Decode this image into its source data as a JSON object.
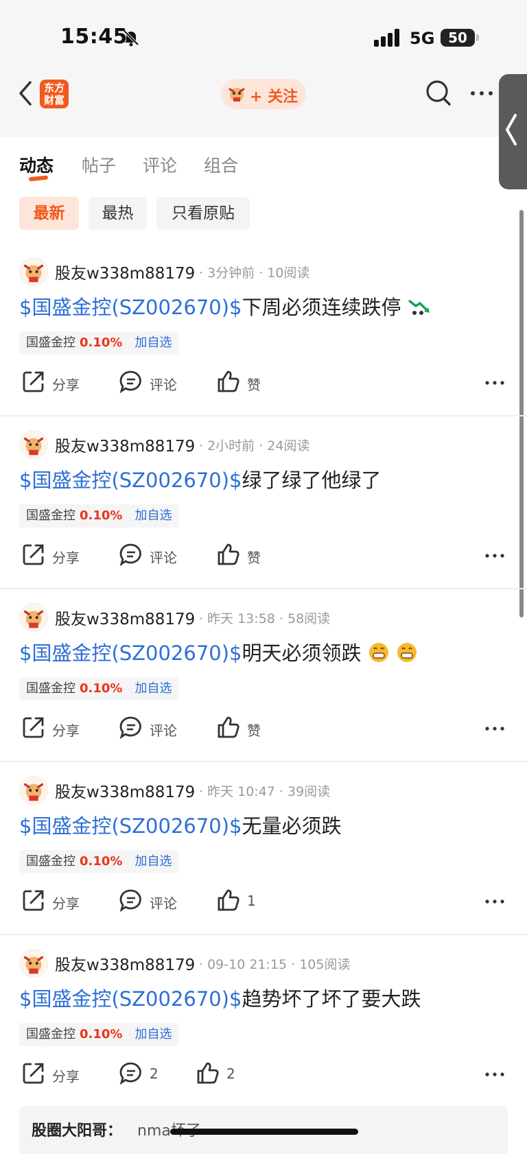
{
  "status_bar": {
    "time": "15:45",
    "network": "5G",
    "battery": "50"
  },
  "header": {
    "logo_text": "东方财富",
    "follow_label": "+ 关注"
  },
  "tabs": [
    {
      "label": "动态",
      "active": true
    },
    {
      "label": "帖子",
      "active": false
    },
    {
      "label": "评论",
      "active": false
    },
    {
      "label": "组合",
      "active": false
    }
  ],
  "filters": [
    {
      "label": "最新",
      "active": true
    },
    {
      "label": "最热",
      "active": false
    },
    {
      "label": "只看原贴",
      "active": false
    }
  ],
  "posts": [
    {
      "user": "股友w338m88179",
      "meta": "· 3分钟前 · 10阅读",
      "stock_link": "$国盛金控(SZ002670)$",
      "text": "下周必须连续跌停",
      "tag_name": "国盛金控",
      "tag_pct": "0.10%",
      "tag_add": "加自选",
      "share": "分享",
      "comment": "评论",
      "like": "赞"
    },
    {
      "user": "股友w338m88179",
      "meta": "· 2小时前 · 24阅读",
      "stock_link": "$国盛金控(SZ002670)$",
      "text": "绿了绿了他绿了",
      "tag_name": "国盛金控",
      "tag_pct": "0.10%",
      "tag_add": "加自选",
      "share": "分享",
      "comment": "评论",
      "like": "赞"
    },
    {
      "user": "股友w338m88179",
      "meta": "· 昨天 13:58 · 58阅读",
      "stock_link": "$国盛金控(SZ002670)$",
      "text": "明天必须领跌",
      "tag_name": "国盛金控",
      "tag_pct": "0.10%",
      "tag_add": "加自选",
      "share": "分享",
      "comment": "评论",
      "like": "赞"
    },
    {
      "user": "股友w338m88179",
      "meta": "· 昨天 10:47 · 39阅读",
      "stock_link": "$国盛金控(SZ002670)$",
      "text": "无量必须跌",
      "tag_name": "国盛金控",
      "tag_pct": "0.10%",
      "tag_add": "加自选",
      "share": "分享",
      "comment": "评论",
      "like": "1"
    },
    {
      "user": "股友w338m88179",
      "meta": "· 09-10 21:15 · 105阅读",
      "stock_link": "$国盛金控(SZ002670)$",
      "text": "趋势坏了坏了要大跌",
      "tag_name": "国盛金控",
      "tag_pct": "0.10%",
      "tag_add": "加自选",
      "share": "分享",
      "comment": "2",
      "like": "2"
    }
  ],
  "reply": {
    "name": "股圈大阳哥：",
    "text": "nma坏了"
  },
  "colors": {
    "accent": "#f15a1f",
    "link": "#2d6fd6",
    "up": "#e8341c"
  }
}
